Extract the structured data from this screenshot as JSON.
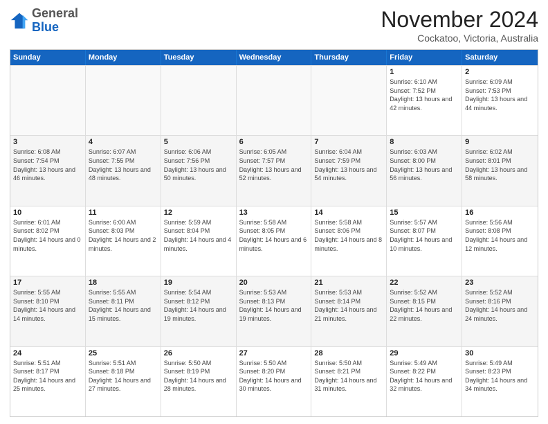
{
  "header": {
    "logo_general": "General",
    "logo_blue": "Blue",
    "month_title": "November 2024",
    "location": "Cockatoo, Victoria, Australia"
  },
  "calendar": {
    "days_of_week": [
      "Sunday",
      "Monday",
      "Tuesday",
      "Wednesday",
      "Thursday",
      "Friday",
      "Saturday"
    ],
    "weeks": [
      [
        {
          "day": "",
          "info": "",
          "empty": true
        },
        {
          "day": "",
          "info": "",
          "empty": true
        },
        {
          "day": "",
          "info": "",
          "empty": true
        },
        {
          "day": "",
          "info": "",
          "empty": true
        },
        {
          "day": "",
          "info": "",
          "empty": true
        },
        {
          "day": "1",
          "info": "Sunrise: 6:10 AM\nSunset: 7:52 PM\nDaylight: 13 hours and 42 minutes."
        },
        {
          "day": "2",
          "info": "Sunrise: 6:09 AM\nSunset: 7:53 PM\nDaylight: 13 hours and 44 minutes."
        }
      ],
      [
        {
          "day": "3",
          "info": "Sunrise: 6:08 AM\nSunset: 7:54 PM\nDaylight: 13 hours and 46 minutes."
        },
        {
          "day": "4",
          "info": "Sunrise: 6:07 AM\nSunset: 7:55 PM\nDaylight: 13 hours and 48 minutes."
        },
        {
          "day": "5",
          "info": "Sunrise: 6:06 AM\nSunset: 7:56 PM\nDaylight: 13 hours and 50 minutes."
        },
        {
          "day": "6",
          "info": "Sunrise: 6:05 AM\nSunset: 7:57 PM\nDaylight: 13 hours and 52 minutes."
        },
        {
          "day": "7",
          "info": "Sunrise: 6:04 AM\nSunset: 7:59 PM\nDaylight: 13 hours and 54 minutes."
        },
        {
          "day": "8",
          "info": "Sunrise: 6:03 AM\nSunset: 8:00 PM\nDaylight: 13 hours and 56 minutes."
        },
        {
          "day": "9",
          "info": "Sunrise: 6:02 AM\nSunset: 8:01 PM\nDaylight: 13 hours and 58 minutes."
        }
      ],
      [
        {
          "day": "10",
          "info": "Sunrise: 6:01 AM\nSunset: 8:02 PM\nDaylight: 14 hours and 0 minutes."
        },
        {
          "day": "11",
          "info": "Sunrise: 6:00 AM\nSunset: 8:03 PM\nDaylight: 14 hours and 2 minutes."
        },
        {
          "day": "12",
          "info": "Sunrise: 5:59 AM\nSunset: 8:04 PM\nDaylight: 14 hours and 4 minutes."
        },
        {
          "day": "13",
          "info": "Sunrise: 5:58 AM\nSunset: 8:05 PM\nDaylight: 14 hours and 6 minutes."
        },
        {
          "day": "14",
          "info": "Sunrise: 5:58 AM\nSunset: 8:06 PM\nDaylight: 14 hours and 8 minutes."
        },
        {
          "day": "15",
          "info": "Sunrise: 5:57 AM\nSunset: 8:07 PM\nDaylight: 14 hours and 10 minutes."
        },
        {
          "day": "16",
          "info": "Sunrise: 5:56 AM\nSunset: 8:08 PM\nDaylight: 14 hours and 12 minutes."
        }
      ],
      [
        {
          "day": "17",
          "info": "Sunrise: 5:55 AM\nSunset: 8:10 PM\nDaylight: 14 hours and 14 minutes."
        },
        {
          "day": "18",
          "info": "Sunrise: 5:55 AM\nSunset: 8:11 PM\nDaylight: 14 hours and 15 minutes."
        },
        {
          "day": "19",
          "info": "Sunrise: 5:54 AM\nSunset: 8:12 PM\nDaylight: 14 hours and 19 minutes."
        },
        {
          "day": "20",
          "info": "Sunrise: 5:53 AM\nSunset: 8:13 PM\nDaylight: 14 hours and 19 minutes."
        },
        {
          "day": "21",
          "info": "Sunrise: 5:53 AM\nSunset: 8:14 PM\nDaylight: 14 hours and 21 minutes."
        },
        {
          "day": "22",
          "info": "Sunrise: 5:52 AM\nSunset: 8:15 PM\nDaylight: 14 hours and 22 minutes."
        },
        {
          "day": "23",
          "info": "Sunrise: 5:52 AM\nSunset: 8:16 PM\nDaylight: 14 hours and 24 minutes."
        }
      ],
      [
        {
          "day": "24",
          "info": "Sunrise: 5:51 AM\nSunset: 8:17 PM\nDaylight: 14 hours and 25 minutes."
        },
        {
          "day": "25",
          "info": "Sunrise: 5:51 AM\nSunset: 8:18 PM\nDaylight: 14 hours and 27 minutes."
        },
        {
          "day": "26",
          "info": "Sunrise: 5:50 AM\nSunset: 8:19 PM\nDaylight: 14 hours and 28 minutes."
        },
        {
          "day": "27",
          "info": "Sunrise: 5:50 AM\nSunset: 8:20 PM\nDaylight: 14 hours and 30 minutes."
        },
        {
          "day": "28",
          "info": "Sunrise: 5:50 AM\nSunset: 8:21 PM\nDaylight: 14 hours and 31 minutes."
        },
        {
          "day": "29",
          "info": "Sunrise: 5:49 AM\nSunset: 8:22 PM\nDaylight: 14 hours and 32 minutes."
        },
        {
          "day": "30",
          "info": "Sunrise: 5:49 AM\nSunset: 8:23 PM\nDaylight: 14 hours and 34 minutes."
        }
      ]
    ]
  }
}
